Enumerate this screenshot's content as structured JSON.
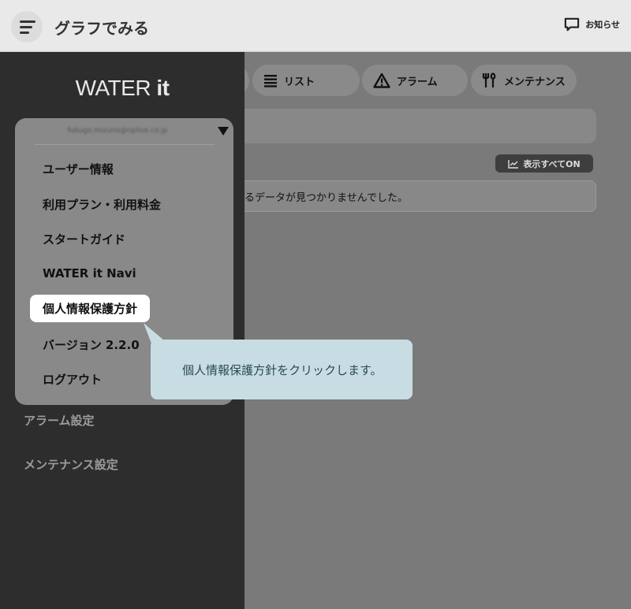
{
  "header": {
    "title": "グラフでみる",
    "notice_label": "お知らせ"
  },
  "tabs": [
    {
      "label": "リスト",
      "icon": "list-icon"
    },
    {
      "label": "アラーム",
      "icon": "warning-icon"
    },
    {
      "label": "メンテナンス",
      "icon": "tools-icon"
    }
  ],
  "content": {
    "show_all_label": "表示すべてON",
    "no_data_text": "るデータが見つかりませんでした。"
  },
  "sidebar": {
    "brand_light": "WATER ",
    "brand_bold": "it",
    "items": [
      {
        "label": "アラーム設定"
      },
      {
        "label": "メンテナンス設定"
      }
    ]
  },
  "dropdown": {
    "email": "fukugo.mizuno@nplive.co.jp",
    "items": [
      {
        "label": "ユーザー情報"
      },
      {
        "label": "利用プラン・利用料金"
      },
      {
        "label": "スタートガイド"
      },
      {
        "label": "WATER it Navi"
      },
      {
        "label": "個人情報保護方針"
      },
      {
        "label": "バージョン 2.2.0"
      },
      {
        "label": "ログアウト"
      }
    ]
  },
  "tooltip": {
    "text": "個人情報保護方針をクリックします。"
  },
  "colors": {
    "sidebar_bg": "#2d2d2d",
    "overlay": "#7a7a7a",
    "tooltip_bg": "#c8dde3",
    "highlight_bg": "#ffffff"
  }
}
